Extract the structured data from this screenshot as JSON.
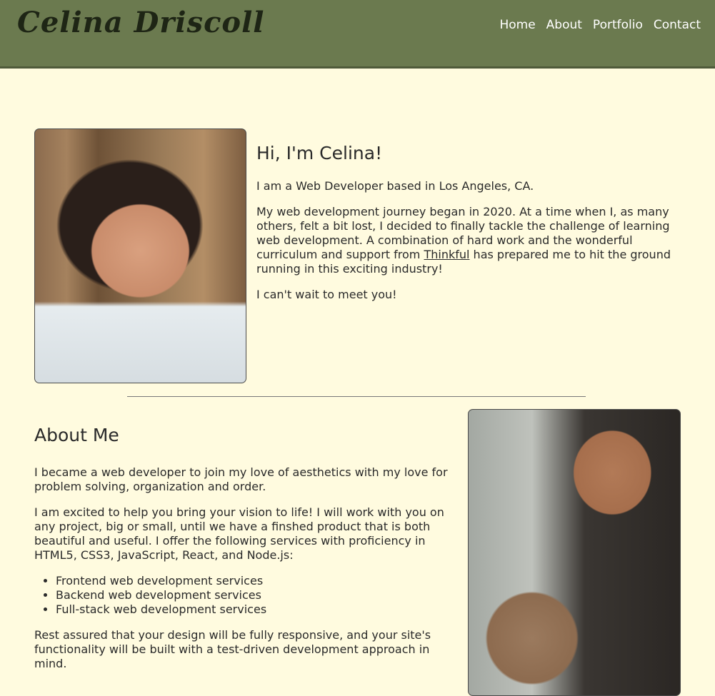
{
  "header": {
    "logo_text": "Celina Driscoll",
    "nav": [
      "Home",
      "About",
      "Portfolio",
      "Contact"
    ]
  },
  "intro": {
    "heading": "Hi, I'm Celina!",
    "p1": "I am a Web Developer based in Los Angeles, CA.",
    "p2_before": "My web development journey began in 2020. At a time when I, as many others, felt a bit lost, I decided to finally tackle the challenge of learning web development. A combination of hard work and the wonderful curriculum and support from ",
    "p2_link": "Thinkful",
    "p2_after": " has prepared me to hit the ground running in this exciting industry!",
    "p3": "I can't wait to meet you!"
  },
  "about": {
    "heading": "About Me",
    "p1": "I became a web developer to join my love of aesthetics with my love for problem solving, organization and order.",
    "p2": "I am excited to help you bring your vision to life! I will work with you on any project, big or small, until we have a finshed product that is both beautiful and useful. I offer the following services with proficiency in HTML5, CSS3, JavaScript, React, and Node.js:",
    "services": [
      "Frontend web development services",
      "Backend web development services",
      "Full-stack web development services"
    ],
    "p3": "Rest assured that your design will be fully responsive, and your site's functionality will be built with a test-driven development approach in mind."
  }
}
